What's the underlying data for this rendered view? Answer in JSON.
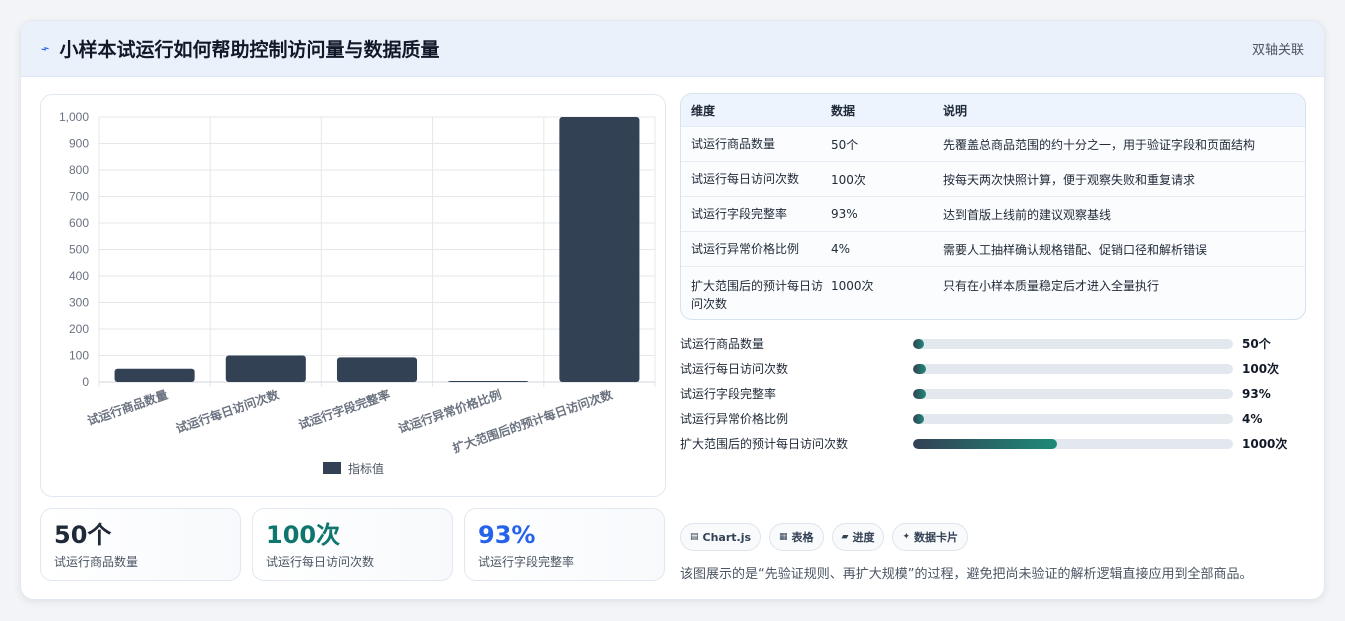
{
  "header": {
    "title": "小样本试运行如何帮助控制访问量与数据质量",
    "tag": "双轴关联",
    "icon": "spark-icon"
  },
  "chart_data": {
    "type": "bar",
    "categories": [
      "试运行商品数量",
      "试运行每日访问次数",
      "试运行字段完整率",
      "试运行异常价格比例",
      "扩大范围后的预计每日访问次数"
    ],
    "series": [
      {
        "name": "指标值",
        "values": [
          50,
          100,
          93,
          4,
          1000
        ]
      }
    ],
    "ylim": [
      0,
      1000
    ],
    "yticks": [
      "0",
      "100",
      "200",
      "300",
      "400",
      "500",
      "600",
      "700",
      "800",
      "900",
      "1,000"
    ],
    "legend": "bottom",
    "grid": true,
    "bar_color": "#334155"
  },
  "stats": [
    {
      "value": "50个",
      "label": "试运行商品数量",
      "color": "#1f2937"
    },
    {
      "value": "100次",
      "label": "试运行每日访问次数",
      "color": "#0f766e"
    },
    {
      "value": "93%",
      "label": "试运行字段完整率",
      "color": "#2563eb"
    }
  ],
  "table": {
    "headers": [
      "维度",
      "数据",
      "说明"
    ],
    "rows": [
      [
        "试运行商品数量",
        "50个",
        "先覆盖总商品范围的约十分之一，用于验证字段和页面结构"
      ],
      [
        "试运行每日访问次数",
        "100次",
        "按每天两次快照计算，便于观察失败和重复请求"
      ],
      [
        "试运行字段完整率",
        "93%",
        "达到首版上线前的建议观察基线"
      ],
      [
        "试运行异常价格比例",
        "4%",
        "需要人工抽样确认规格错配、促销口径和解析错误"
      ],
      [
        "扩大范围后的预计每日访问次数",
        "1000次",
        "只有在小样本质量稳定后才进入全量执行"
      ]
    ]
  },
  "progress": [
    {
      "label": "试运行商品数量",
      "value": "50个",
      "fraction": 0.02
    },
    {
      "label": "试运行每日访问次数",
      "value": "100次",
      "fraction": 0.04
    },
    {
      "label": "试运行字段完整率",
      "value": "93%",
      "fraction": 0.04
    },
    {
      "label": "试运行异常价格比例",
      "value": "4%",
      "fraction": 0.03
    },
    {
      "label": "扩大范围后的预计每日访问次数",
      "value": "1000次",
      "fraction": 0.45
    }
  ],
  "chips": [
    {
      "icon": "chart-icon",
      "label": "Chart.js"
    },
    {
      "icon": "table-icon",
      "label": "表格"
    },
    {
      "icon": "progress-icon",
      "label": "进度"
    },
    {
      "icon": "card-icon",
      "label": "数据卡片"
    }
  ],
  "note": "该图展示的是“先验证规则、再扩大规模”的过程，避免把尚未验证的解析逻辑直接应用到全部商品。"
}
